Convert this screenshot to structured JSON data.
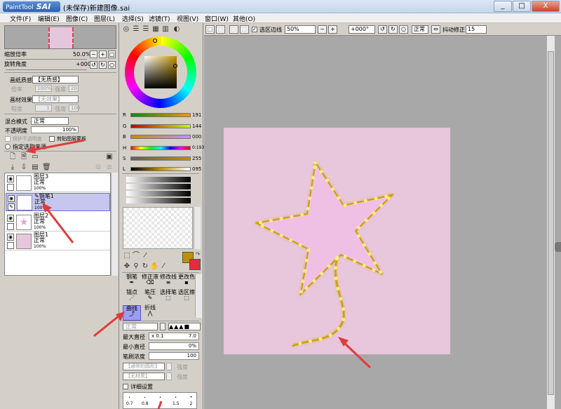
{
  "window": {
    "logo_small": "PaintTool",
    "logo_big": "SAI",
    "title": "(未保存)新建图像.sai",
    "minimize": "_",
    "maximize": "□",
    "close": "X"
  },
  "menu": [
    "文件(F)",
    "编辑(E)",
    "图像(C)",
    "图层(L)",
    "选择(S)",
    "滤镜(T)",
    "视图(V)",
    "窗口(W)",
    "其他(O)"
  ],
  "navigator": {
    "zoom_label": "缩放倍率",
    "zoom_value": "50.0%",
    "rotate_label": "旋转角度",
    "rotate_value": "+000"
  },
  "layer_props": {
    "paper_texture_label": "画纸质感",
    "paper_texture_value": "【无质感】",
    "magnification_label": "倍率",
    "magnification_value": "100%",
    "strength_label": "强度",
    "strength_value": "20",
    "effect_label": "画材效果",
    "effect_value": "【无效果】",
    "depth_label": "程度",
    "depth_value": "1",
    "strength2_label": "强度",
    "strength2_value": "100",
    "blend_label": "混合模式",
    "blend_value": "正常",
    "opacity_label": "不透明度",
    "opacity_value": "100%",
    "protect_label": "保护不透明度",
    "clip_label": "剪贴图层蒙板",
    "selection_source_label": "指定选取来源"
  },
  "layers": [
    {
      "name": "图层3",
      "mode": "正常",
      "opacity": "100%"
    },
    {
      "name": "钢笔1",
      "mode": "正常",
      "opacity": "100%"
    },
    {
      "name": "图层2",
      "mode": "正常",
      "opacity": "100%"
    },
    {
      "name": "图层1",
      "mode": "正常",
      "opacity": "100%"
    }
  ],
  "color": {
    "sliders": [
      {
        "label": "R",
        "value": "191"
      },
      {
        "label": "G",
        "value": "144"
      },
      {
        "label": "B",
        "value": "000"
      },
      {
        "label": "H",
        "value": "0:193"
      },
      {
        "label": "S",
        "value": "255"
      },
      {
        "label": "L",
        "value": "095"
      }
    ],
    "primary": "#bf9000",
    "secondary": "#e8283c"
  },
  "tools": {
    "row1": [
      "钢笔",
      "修正液",
      "修改线",
      "更改色"
    ],
    "row2": [
      "锚点",
      "笔压",
      "选择笔",
      "选区擦"
    ],
    "row3": [
      "曲线",
      "折线"
    ]
  },
  "brush": {
    "mode_value": "正常",
    "max_size_label": "最大直径",
    "max_size_mult": "x 0.1",
    "max_size_value": "7.0",
    "min_size_label": "最小直径",
    "min_size_value": "0%",
    "density_label": "笔刷浓度",
    "density_value": "100",
    "shape1": "【通常的圆形】",
    "shape1_strength_label": "强度",
    "shape2": "【无材质】",
    "shape2_strength_label": "强度",
    "detail_label": "详细设置",
    "sizes": [
      "0.7",
      "0.8",
      "1",
      "1.5",
      "2"
    ]
  },
  "canvas_toolbar": {
    "selection_edge_label": "选区边线",
    "zoom_value": "50%",
    "rotate_value": "+000°",
    "mode_value": "正常",
    "stabilizer_label": "抖动修正",
    "stabilizer_value": "15"
  },
  "art": {
    "paper_color": "#e8c6dc",
    "star_fill": "#efbfe4",
    "line_color": "#c9a000"
  }
}
